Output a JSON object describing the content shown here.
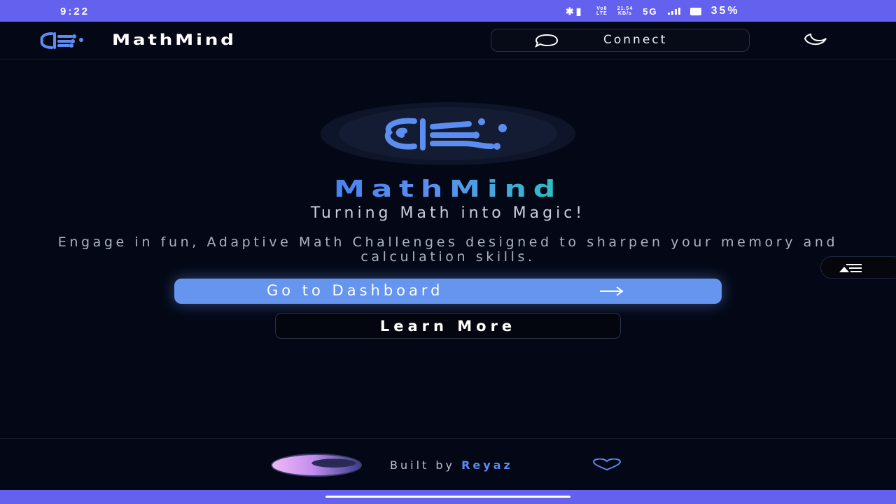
{
  "status_bar": {
    "time": "9:22",
    "bluetooth_icon": "bluetooth-icon",
    "volte_top": "Vo8",
    "volte_bottom": "LTE",
    "speed_top": "21.54",
    "speed_bottom": "KB/s",
    "network": "5G",
    "battery_pct": "35%"
  },
  "header": {
    "brand": "MathMind",
    "connect_label": "Connect",
    "connect_icon": "chat-bubble-icon",
    "theme_icon": "moon-icon"
  },
  "hero": {
    "title": "MathMind",
    "subtitle": "Turning Math into Magic!",
    "description": "Engage in fun, Adaptive Math Challenges designed to sharpen your memory and calculation skills.",
    "primary_button": "Go to Dashboard",
    "secondary_button": "Learn More"
  },
  "footer": {
    "built_by": "Built by",
    "author": "Reyaz"
  },
  "colors": {
    "accent": "#6595ee",
    "status_bar": "#6461ef",
    "background": "#040816",
    "gradient_end": "#2bc1c1"
  }
}
